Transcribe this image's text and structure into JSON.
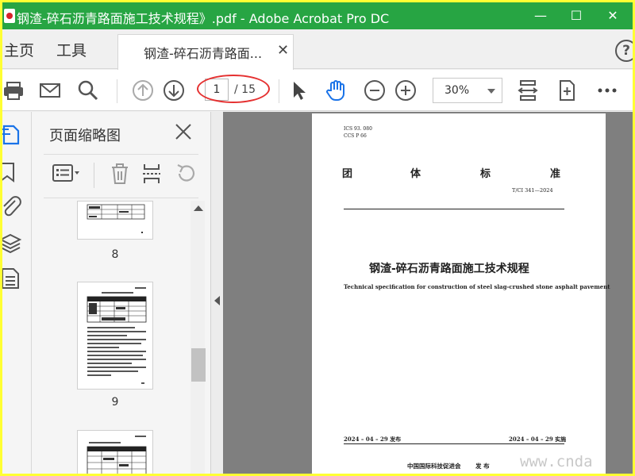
{
  "window": {
    "title": "钢渣-碎石沥青路面施工技术规程》.pdf - Adobe Acrobat Pro DC",
    "minimize": "—",
    "maximize": "☐",
    "close": "✕"
  },
  "tabs": {
    "home": "主页",
    "tools": "工具",
    "document_tab": "钢渣-碎石沥青路面...",
    "help": "?"
  },
  "toolbar": {
    "page_current": "1",
    "page_total": "/ 15",
    "zoom": "30%",
    "icons": [
      "print-icon",
      "email-icon",
      "search-icon",
      "page-up-icon",
      "page-down-icon",
      "select-cursor-icon",
      "hand-tool-icon",
      "zoom-out-icon",
      "zoom-in-icon",
      "fit-page-icon",
      "scroll-mode-icon",
      "more-icon"
    ]
  },
  "sidebar_rail": {
    "icons": [
      "page-thumbnails-icon",
      "bookmark-icon",
      "attachment-icon",
      "layers-icon",
      "article-icon"
    ]
  },
  "thumbnails_panel": {
    "title": "页面缩略图",
    "pages": [
      {
        "label": "8"
      },
      {
        "label": "9"
      },
      {
        "label": ""
      }
    ]
  },
  "document": {
    "ics": "ICS  93. 080",
    "ccs": "CCS  P  66",
    "standard_type_chars": [
      "团",
      "体",
      "标",
      "准"
    ],
    "standard_number": "T/CI  341—2024",
    "title_cn": "钢渣-碎石沥青路面施工技术规程",
    "title_en": "Technical specification for construction of steel slag-crushed stone asphalt pavement",
    "publish_date": "2024 – 04 – 29 发布",
    "implement_date": "2024 – 04 – 29 实施",
    "publisher": "中国国际科技促进会",
    "publish_word": "发  布"
  },
  "watermark": "www.cnda",
  "colors": {
    "titlebar": "#27a543",
    "highlight_ring": "#e53030",
    "active_tool": "#1a73e8",
    "outer_border": "#ffff33"
  }
}
